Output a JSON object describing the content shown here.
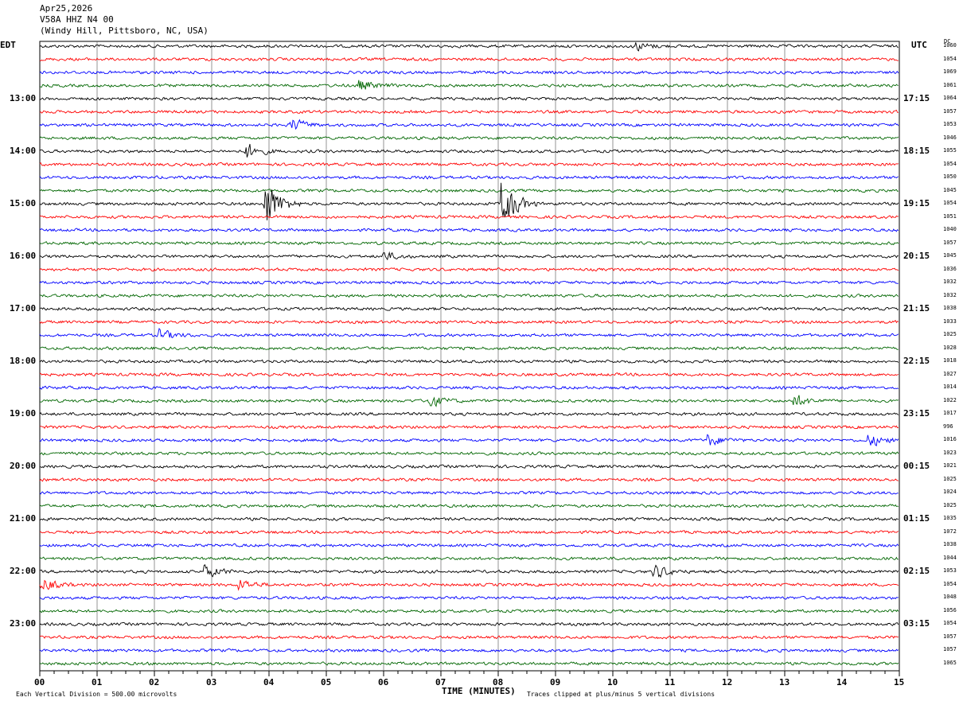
{
  "header": {
    "date": "Apr25,2026",
    "station": "V58A HHZ N4 00",
    "location": "(Windy Hill, Pittsboro, NC, USA)"
  },
  "left_tz": "EDT",
  "right_tz": "UTC",
  "dc_header": "DC",
  "chart_data": {
    "type": "line",
    "subtype": "helicorder",
    "xlabel": "TIME (MINUTES)",
    "xlim": [
      0,
      15
    ],
    "x_ticks": [
      "00",
      "01",
      "02",
      "03",
      "04",
      "05",
      "06",
      "07",
      "08",
      "09",
      "10",
      "11",
      "12",
      "13",
      "14",
      "15"
    ],
    "trace_minutes": 15,
    "trace_colors": [
      "#000000",
      "#ff0000",
      "#0000ff",
      "#006600"
    ],
    "left_hour_labels": [
      "13:00",
      "14:00",
      "15:00",
      "16:00",
      "17:00",
      "18:00",
      "19:00",
      "20:00",
      "21:00",
      "22:00",
      "23:00"
    ],
    "right_hour_labels": [
      "17:15",
      "18:15",
      "19:15",
      "20:15",
      "21:15",
      "22:15",
      "23:15",
      "00:15",
      "01:15",
      "02:15",
      "03:15"
    ],
    "first_labeled_trace": 4,
    "traces_per_hour": 4,
    "dc_offsets": [
      1060,
      1054,
      1069,
      1061,
      1064,
      1057,
      1053,
      1046,
      1055,
      1054,
      1050,
      1045,
      1054,
      1051,
      1040,
      1057,
      1045,
      1036,
      1032,
      1032,
      1038,
      1033,
      1025,
      1028,
      1018,
      1027,
      1014,
      1022,
      1017,
      996,
      1016,
      1023,
      1021,
      1025,
      1024,
      1025,
      1035,
      1072,
      1038,
      1044,
      1053,
      1054,
      1048,
      1056,
      1054,
      1057,
      1057,
      1065
    ],
    "events": [
      {
        "trace": 12,
        "minute": 3.95,
        "amplitude": 5
      },
      {
        "trace": 12,
        "minute": 8.1,
        "amplitude": 4.5
      },
      {
        "trace": 8,
        "minute": 3.6,
        "amplitude": 1.5
      },
      {
        "trace": 6,
        "minute": 4.4,
        "amplitude": 1.2
      },
      {
        "trace": 3,
        "minute": 5.6,
        "amplitude": 1
      },
      {
        "trace": 0,
        "minute": 10.4,
        "amplitude": 0.8
      },
      {
        "trace": 16,
        "minute": 6.0,
        "amplitude": 0.8
      },
      {
        "trace": 22,
        "minute": 2.1,
        "amplitude": 1
      },
      {
        "trace": 27,
        "minute": 6.8,
        "amplitude": 1.2
      },
      {
        "trace": 27,
        "minute": 13.2,
        "amplitude": 1
      },
      {
        "trace": 30,
        "minute": 11.7,
        "amplitude": 1
      },
      {
        "trace": 30,
        "minute": 14.5,
        "amplitude": 1
      },
      {
        "trace": 40,
        "minute": 2.9,
        "amplitude": 1.2
      },
      {
        "trace": 40,
        "minute": 10.75,
        "amplitude": 1.2
      },
      {
        "trace": 41,
        "minute": 0.05,
        "amplitude": 1.2
      },
      {
        "trace": 41,
        "minute": 3.5,
        "amplitude": 1
      }
    ],
    "clip_divisions": 5
  },
  "footer": {
    "scale": "Each Vertical Division =  500.00 microvolts",
    "clip_note": "Traces clipped at plus/minus 5 vertical divisions"
  }
}
